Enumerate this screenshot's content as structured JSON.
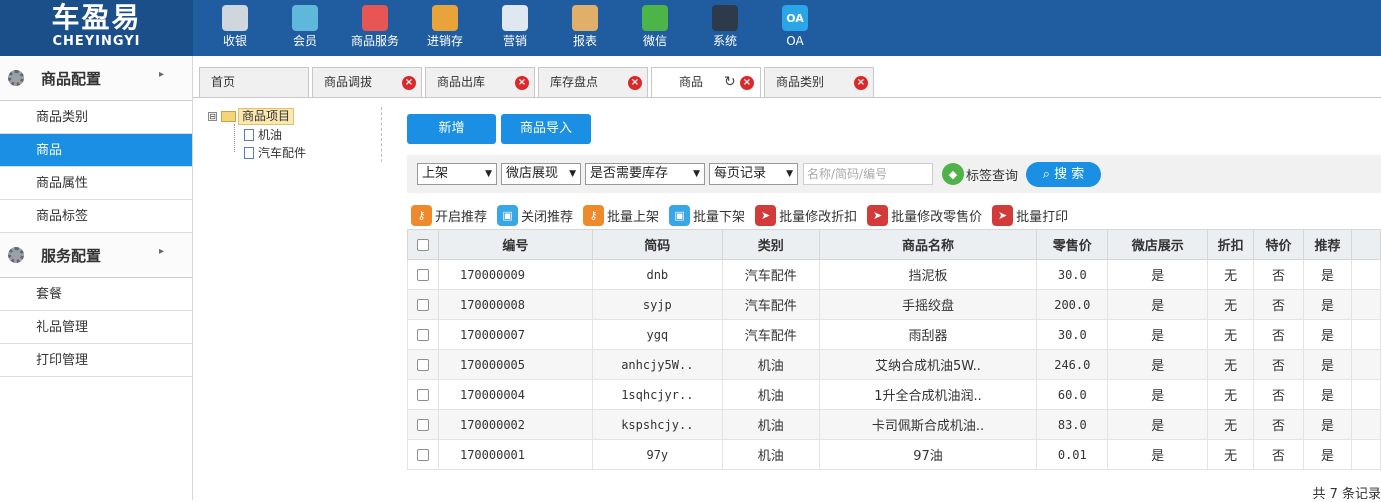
{
  "logo": {
    "big": "车盈易",
    "small": "CHEYINGYI"
  },
  "nav": [
    {
      "label": "收银",
      "icon": "cash-register-icon",
      "color": "#cfd6de"
    },
    {
      "label": "会员",
      "icon": "member-icon",
      "color": "#5fb8d9"
    },
    {
      "label": "商品服务",
      "icon": "product-service-icon",
      "color": "#e85555"
    },
    {
      "label": "进销存",
      "icon": "inventory-icon",
      "color": "#e8a33a"
    },
    {
      "label": "营销",
      "icon": "megaphone-icon",
      "color": "#dfe8f0"
    },
    {
      "label": "报表",
      "icon": "report-icon",
      "color": "#e0b06a"
    },
    {
      "label": "微信",
      "icon": "wechat-icon",
      "color": "#4db548"
    },
    {
      "label": "系统",
      "icon": "monitor-icon",
      "color": "#2d3a4a"
    },
    {
      "label": "OA",
      "icon": "oa-icon",
      "color": "#2aa5e8",
      "text": "OA"
    }
  ],
  "sidebar": {
    "section1": {
      "title": "商品配置",
      "items": [
        "商品类别",
        "商品",
        "商品属性",
        "商品标签"
      ],
      "active": 1
    },
    "section2": {
      "title": "服务配置",
      "items": [
        "套餐",
        "礼品管理",
        "打印管理"
      ]
    }
  },
  "tabs": [
    {
      "label": "首页",
      "closable": false
    },
    {
      "label": "商品调拔",
      "closable": true
    },
    {
      "label": "商品出库",
      "closable": true
    },
    {
      "label": "库存盘点",
      "closable": true
    },
    {
      "label": "商品",
      "closable": true,
      "active": true,
      "refresh": "↻"
    },
    {
      "label": "商品类别",
      "closable": true
    }
  ],
  "tree": {
    "root": "商品项目",
    "children": [
      "机油",
      "汽车配件"
    ],
    "toggle": "⊟"
  },
  "buttons": {
    "add": "新增",
    "import": "商品导入"
  },
  "filters": {
    "status": "上架",
    "shop": "微店展现",
    "stock": "是否需要库存",
    "page_size": "每页记录",
    "search_placeholder": "名称/简码/编号",
    "tag_query": "标签查询",
    "search": "搜 索"
  },
  "actions": [
    {
      "label": "开启推荐",
      "icon": "key-icon",
      "color": "orange"
    },
    {
      "label": "关闭推荐",
      "icon": "lock-icon",
      "color": "blue"
    },
    {
      "label": "批量上架",
      "icon": "key-icon",
      "color": "orange"
    },
    {
      "label": "批量下架",
      "icon": "lock-icon",
      "color": "blue"
    },
    {
      "label": "批量修改折扣",
      "icon": "send-icon",
      "color": "red"
    },
    {
      "label": "批量修改零售价",
      "icon": "send-icon",
      "color": "red"
    },
    {
      "label": "批量打印",
      "icon": "send-icon",
      "color": "red"
    }
  ],
  "table": {
    "headers": [
      "编号",
      "简码",
      "类别",
      "商品名称",
      "零售价",
      "微店展示",
      "折扣",
      "特价",
      "推荐"
    ],
    "rows": [
      [
        "170000009",
        "dnb",
        "汽车配件",
        "挡泥板",
        "30.0",
        "是",
        "无",
        "否",
        "是"
      ],
      [
        "170000008",
        "syjp",
        "汽车配件",
        "手摇绞盘",
        "200.0",
        "是",
        "无",
        "否",
        "是"
      ],
      [
        "170000007",
        "ygq",
        "汽车配件",
        "雨刮器",
        "30.0",
        "是",
        "无",
        "否",
        "是"
      ],
      [
        "170000005",
        "anhcjy5W..",
        "机油",
        "艾纳合成机油5W..",
        "246.0",
        "是",
        "无",
        "否",
        "是"
      ],
      [
        "170000004",
        "1sqhcjyr..",
        "机油",
        "1升全合成机油润..",
        "60.0",
        "是",
        "无",
        "否",
        "是"
      ],
      [
        "170000002",
        "kspshcjy..",
        "机油",
        "卡司佩斯合成机油..",
        "83.0",
        "是",
        "无",
        "否",
        "是"
      ],
      [
        "170000001",
        "97y",
        "机油",
        "97油",
        "0.01",
        "是",
        "无",
        "否",
        "是"
      ]
    ]
  },
  "footer": "共 7 条记录"
}
